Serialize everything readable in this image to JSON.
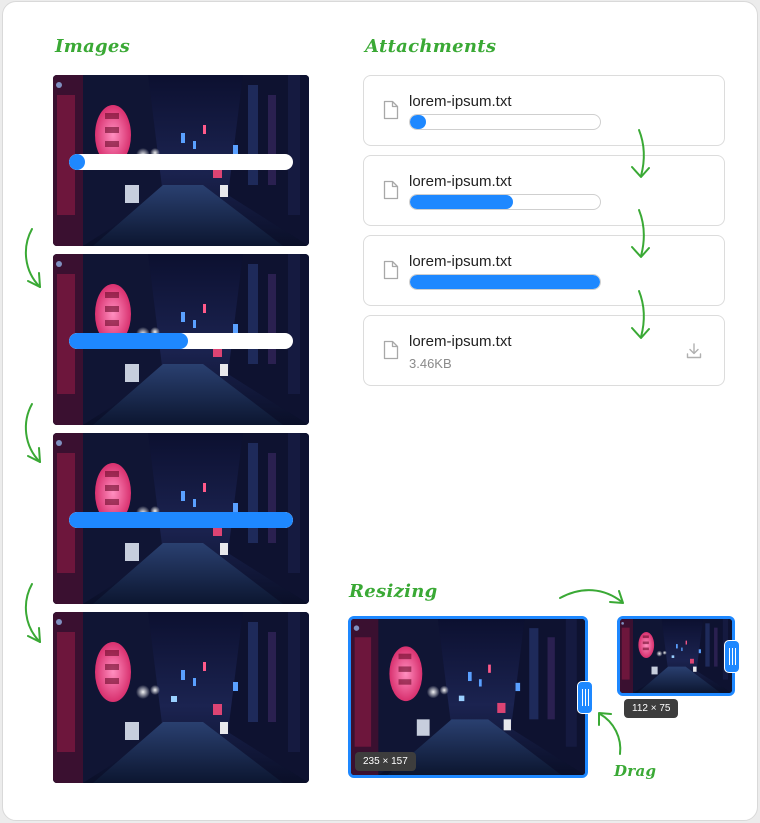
{
  "sections": {
    "images_title": "Images",
    "attachments_title": "Attachments",
    "resizing_title": "Resizing"
  },
  "images": [
    {
      "progress": 0.05
    },
    {
      "progress": 0.53
    },
    {
      "progress": 1.0
    },
    {
      "progress": null
    }
  ],
  "attachments": [
    {
      "name": "lorem-ipsum.txt",
      "progress": 0.08,
      "size": ""
    },
    {
      "name": "lorem-ipsum.txt",
      "progress": 0.54,
      "size": ""
    },
    {
      "name": "lorem-ipsum.txt",
      "progress": 1.0,
      "size": ""
    },
    {
      "name": "lorem-ipsum.txt",
      "progress": null,
      "size": "3.46KB"
    }
  ],
  "resizing": {
    "large_dimensions": "235 × 157",
    "small_dimensions": "112 × 75",
    "drag_label": "Drag"
  },
  "colors": {
    "accent": "#1e88ff",
    "annotation_green": "#3aa935"
  },
  "icons": [
    "file-icon",
    "download-icon",
    "arrow-down-icon",
    "arrow-right-icon",
    "drag-handle-icon"
  ]
}
